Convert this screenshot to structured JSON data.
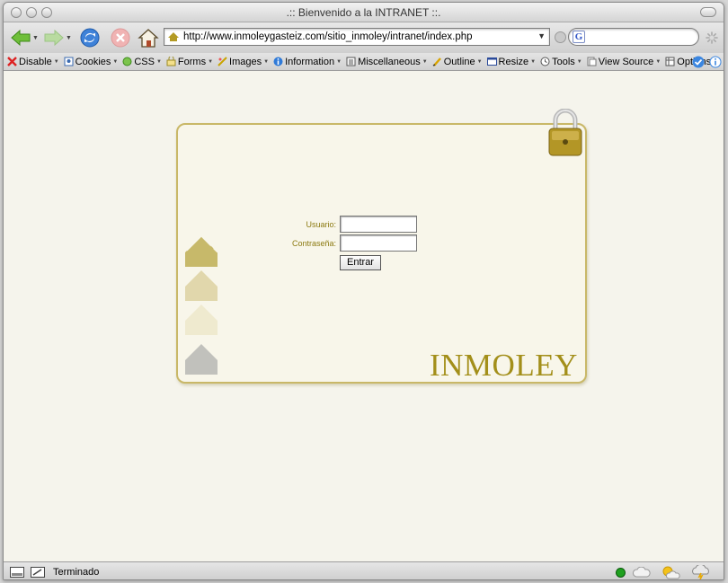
{
  "window": {
    "title": ".:: Bienvenido a la INTRANET ::."
  },
  "navigation": {
    "url": "http://www.inmoleygasteiz.com/sitio_inmoley/intranet/index.php",
    "search_value": ""
  },
  "dev_toolbar": {
    "items": [
      {
        "label": "Disable",
        "icon": "disable-icon"
      },
      {
        "label": "Cookies",
        "icon": "cookies-icon"
      },
      {
        "label": "CSS",
        "icon": "css-icon"
      },
      {
        "label": "Forms",
        "icon": "forms-icon"
      },
      {
        "label": "Images",
        "icon": "images-icon"
      },
      {
        "label": "Information",
        "icon": "information-icon"
      },
      {
        "label": "Miscellaneous",
        "icon": "miscellaneous-icon"
      },
      {
        "label": "Outline",
        "icon": "outline-icon"
      },
      {
        "label": "Resize",
        "icon": "resize-icon"
      },
      {
        "label": "Tools",
        "icon": "tools-icon"
      },
      {
        "label": "View Source",
        "icon": "view-source-icon"
      },
      {
        "label": "Options",
        "icon": "options-icon"
      }
    ]
  },
  "login": {
    "username_label": "Usuario:",
    "username_value": "",
    "password_label": "Contraseña:",
    "password_value": "",
    "submit_label": "Entrar",
    "brand": "INMOLEY"
  },
  "status": {
    "text": "Terminado"
  },
  "colors": {
    "page_background": "#f5f4ec",
    "panel_border": "#c9b868",
    "brand_gold": "#a38f1a",
    "label_gold": "#8c7a12"
  }
}
